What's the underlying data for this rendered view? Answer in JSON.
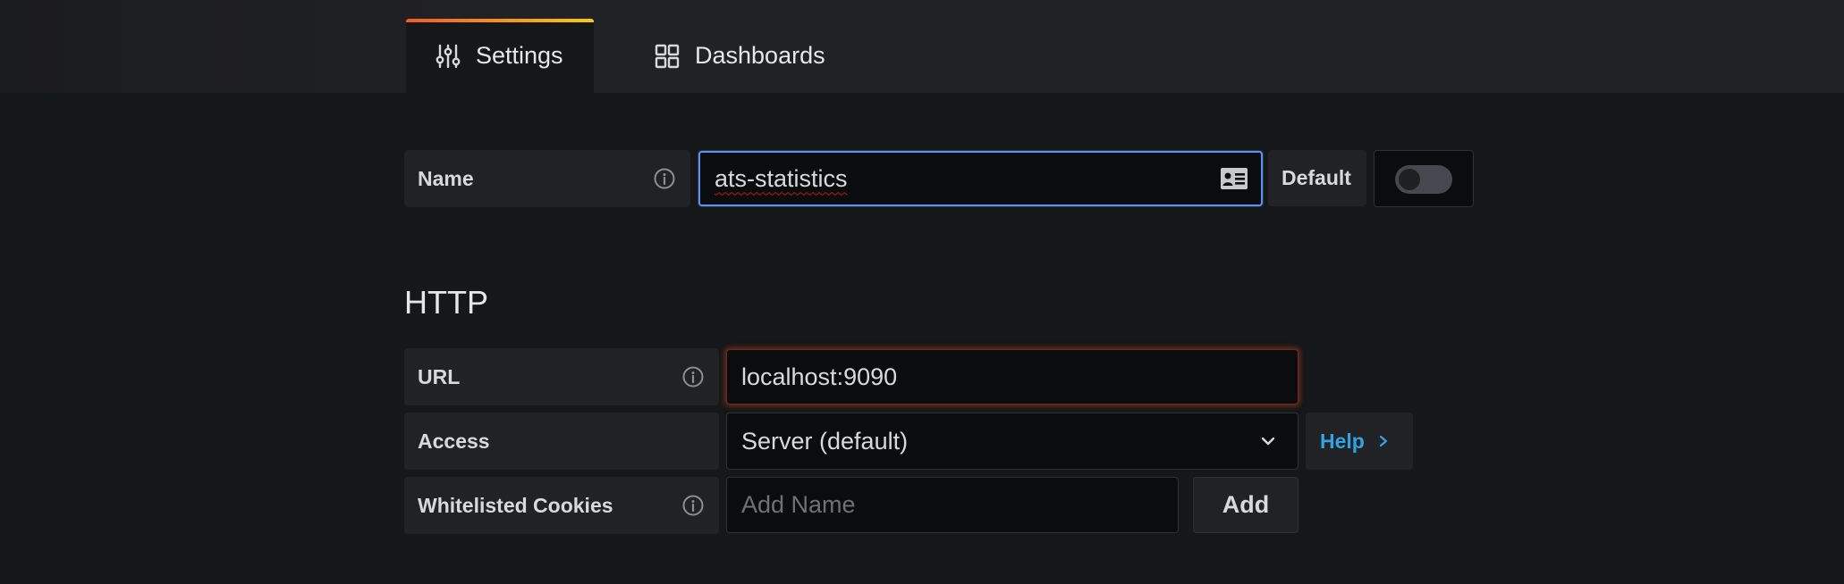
{
  "tabs": [
    {
      "label": "Settings",
      "icon": "sliders-icon",
      "active": true
    },
    {
      "label": "Dashboards",
      "icon": "apps-grid-icon",
      "active": false
    }
  ],
  "name_row": {
    "label": "Name",
    "value": "ats-statistics",
    "default_label": "Default",
    "default_on": false
  },
  "http": {
    "title": "HTTP",
    "url_label": "URL",
    "url_value": "localhost:9090",
    "access_label": "Access",
    "access_value": "Server (default)",
    "help_label": "Help",
    "cookies_label": "Whitelisted Cookies",
    "cookies_placeholder": "Add Name",
    "add_label": "Add"
  },
  "colors": {
    "background": "#161719",
    "field_label_bg": "#202226",
    "input_bg": "#0b0c0e",
    "focus_border": "#5794f2",
    "link_blue": "#33a2e5",
    "tab_accent_start": "#f05a28",
    "tab_accent_end": "#fbca0a",
    "error_glow": "#c4462a"
  }
}
